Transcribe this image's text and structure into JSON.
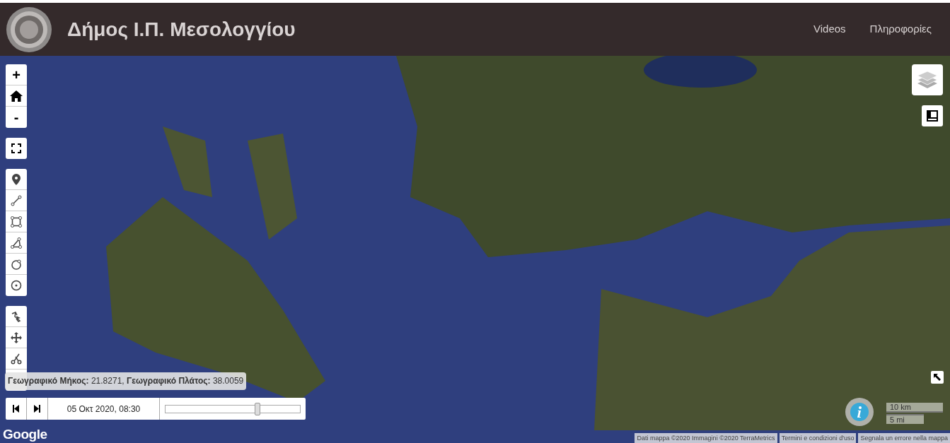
{
  "header": {
    "title": "Δήμος Ι.Π. Μεσολογγίου",
    "nav": [
      "Videos",
      "Πληροφορίες"
    ]
  },
  "map": {
    "zoom_in": "+",
    "zoom_out": "-",
    "coordinates": "**Γεωγραφικό Μήκος:** 21.8271, **Γεωγραφικό Πλάτος:** 38.0059",
    "timeline": {
      "date": "05 Οκτ 2020, 08:30",
      "level": 0.68
    },
    "logo": "Google",
    "scale": [
      "10 km",
      "5 mi"
    ],
    "attribution": [
      "Dati mappa ©2020 Immagini ©2020 TerraMetrics",
      "Termini e condizioni d'uso",
      "Segnala un errore nella mappa"
    ]
  }
}
